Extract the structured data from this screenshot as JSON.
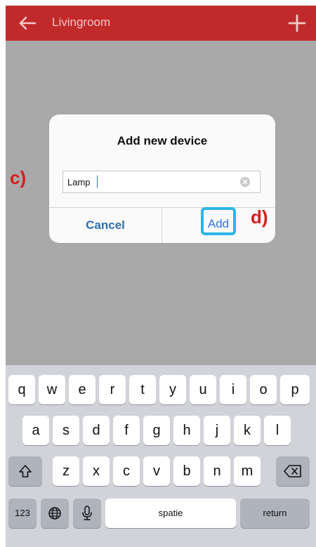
{
  "header": {
    "title": "Livingroom",
    "back_icon": "arrow-left-icon",
    "add_icon": "plus-icon",
    "color": "#c12a2a"
  },
  "dialog": {
    "title": "Add new device",
    "input_value": "Lamp",
    "cancel_label": "Cancel",
    "add_label": "Add"
  },
  "annotations": {
    "c": "c)",
    "d": "d)"
  },
  "keyboard": {
    "row1": [
      "q",
      "w",
      "e",
      "r",
      "t",
      "y",
      "u",
      "i",
      "o",
      "p"
    ],
    "row2": [
      "a",
      "s",
      "d",
      "f",
      "g",
      "h",
      "j",
      "k",
      "l"
    ],
    "row3": [
      "z",
      "x",
      "c",
      "v",
      "b",
      "n",
      "m"
    ],
    "numbers_label": "123",
    "space_label": "spatie",
    "return_label": "return"
  }
}
